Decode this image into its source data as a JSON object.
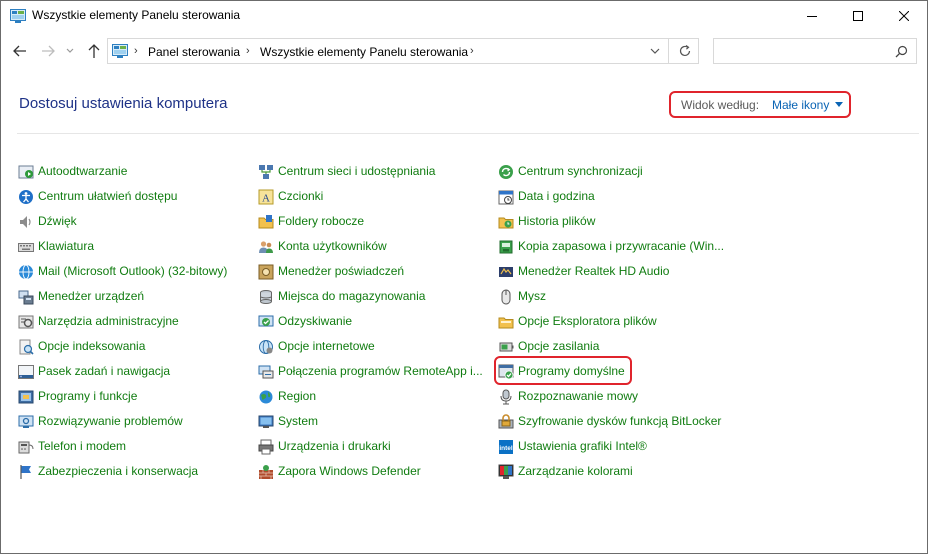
{
  "window": {
    "title": "Wszystkie elementy Panelu sterowania"
  },
  "nav": {
    "breadcrumb": [
      "Panel sterowania",
      "Wszystkie elementy Panelu sterowania"
    ],
    "search_placeholder": ""
  },
  "header": {
    "title": "Dostosuj ustawienia komputera",
    "view_label": "Widok według:",
    "view_value": "Małe ikony"
  },
  "colors": {
    "link_green": "#107c10",
    "title_blue": "#1e3287",
    "highlight_red": "#e0242c"
  },
  "columns": [
    [
      {
        "label": "Autoodtwarzanie",
        "icon": "autoplay-icon"
      },
      {
        "label": "Centrum ułatwień dostępu",
        "icon": "ease-of-access-icon"
      },
      {
        "label": "Dźwięk",
        "icon": "sound-icon"
      },
      {
        "label": "Klawiatura",
        "icon": "keyboard-icon"
      },
      {
        "label": "Mail (Microsoft Outlook) (32-bitowy)",
        "icon": "mail-icon"
      },
      {
        "label": "Menedżer urządzeń",
        "icon": "device-manager-icon"
      },
      {
        "label": "Narzędzia administracyjne",
        "icon": "admin-tools-icon"
      },
      {
        "label": "Opcje indeksowania",
        "icon": "indexing-icon"
      },
      {
        "label": "Pasek zadań i nawigacja",
        "icon": "taskbar-icon"
      },
      {
        "label": "Programy i funkcje",
        "icon": "programs-icon"
      },
      {
        "label": "Rozwiązywanie problemów",
        "icon": "troubleshooting-icon"
      },
      {
        "label": "Telefon i modem",
        "icon": "phone-modem-icon"
      },
      {
        "label": "Zabezpieczenia i konserwacja",
        "icon": "security-flag-icon"
      }
    ],
    [
      {
        "label": "Centrum sieci i udostępniania",
        "icon": "network-icon"
      },
      {
        "label": "Czcionki",
        "icon": "fonts-icon"
      },
      {
        "label": "Foldery robocze",
        "icon": "work-folders-icon"
      },
      {
        "label": "Konta użytkowników",
        "icon": "user-accounts-icon"
      },
      {
        "label": "Menedżer poświadczeń",
        "icon": "credential-manager-icon"
      },
      {
        "label": "Miejsca do magazynowania",
        "icon": "storage-spaces-icon"
      },
      {
        "label": "Odzyskiwanie",
        "icon": "recovery-icon"
      },
      {
        "label": "Opcje internetowe",
        "icon": "internet-options-icon"
      },
      {
        "label": "Połączenia programów RemoteApp i...",
        "icon": "remoteapp-icon"
      },
      {
        "label": "Region",
        "icon": "region-icon"
      },
      {
        "label": "System",
        "icon": "system-icon"
      },
      {
        "label": "Urządzenia i drukarki",
        "icon": "printer-icon"
      },
      {
        "label": "Zapora Windows Defender",
        "icon": "firewall-icon"
      }
    ],
    [
      {
        "label": "Centrum synchronizacji",
        "icon": "sync-icon"
      },
      {
        "label": "Data i godzina",
        "icon": "date-time-icon"
      },
      {
        "label": "Historia plików",
        "icon": "file-history-icon"
      },
      {
        "label": "Kopia zapasowa i przywracanie (Win...",
        "icon": "backup-icon"
      },
      {
        "label": "Menedżer Realtek HD Audio",
        "icon": "realtek-icon"
      },
      {
        "label": "Mysz",
        "icon": "mouse-icon"
      },
      {
        "label": "Opcje Eksploratora plików",
        "icon": "explorer-options-icon"
      },
      {
        "label": "Opcje zasilania",
        "icon": "power-icon"
      },
      {
        "label": "Programy domyślne",
        "icon": "default-programs-icon"
      },
      {
        "label": "Rozpoznawanie mowy",
        "icon": "speech-icon"
      },
      {
        "label": "Szyfrowanie dysków funkcją BitLocker",
        "icon": "bitlocker-icon"
      },
      {
        "label": "Ustawienia grafiki Intel®",
        "icon": "intel-graphics-icon"
      },
      {
        "label": "Zarządzanie kolorami",
        "icon": "color-management-icon"
      }
    ]
  ]
}
